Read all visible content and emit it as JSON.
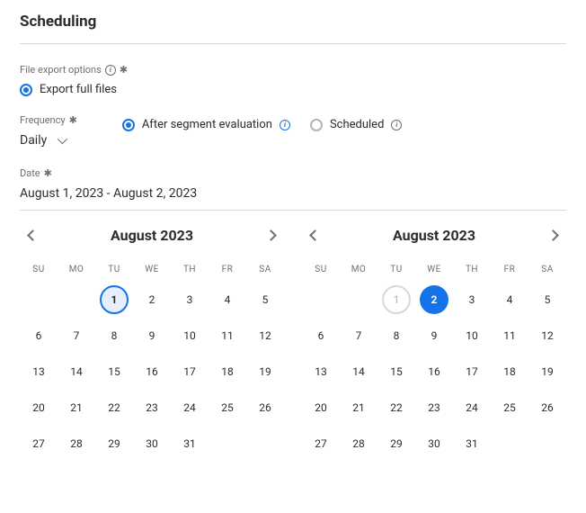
{
  "title": "Scheduling",
  "export": {
    "label": "File export options",
    "option": "Export full files"
  },
  "frequency": {
    "label": "Frequency",
    "select": "Daily",
    "options": {
      "after": "After segment evaluation",
      "scheduled": "Scheduled"
    }
  },
  "date": {
    "label": "Date",
    "range": "August 1, 2023 - August 2, 2023"
  },
  "dow": [
    "SU",
    "MO",
    "TU",
    "WE",
    "TH",
    "FR",
    "SA"
  ],
  "cal1": {
    "title": "August 2023",
    "firstDow": 2,
    "days": 31,
    "selected": 1,
    "selectedStyle": "ring"
  },
  "cal2": {
    "title": "August 2023",
    "firstDow": 2,
    "days": 31,
    "selected": 2,
    "selectedStyle": "solid",
    "disabled": [
      1
    ]
  }
}
